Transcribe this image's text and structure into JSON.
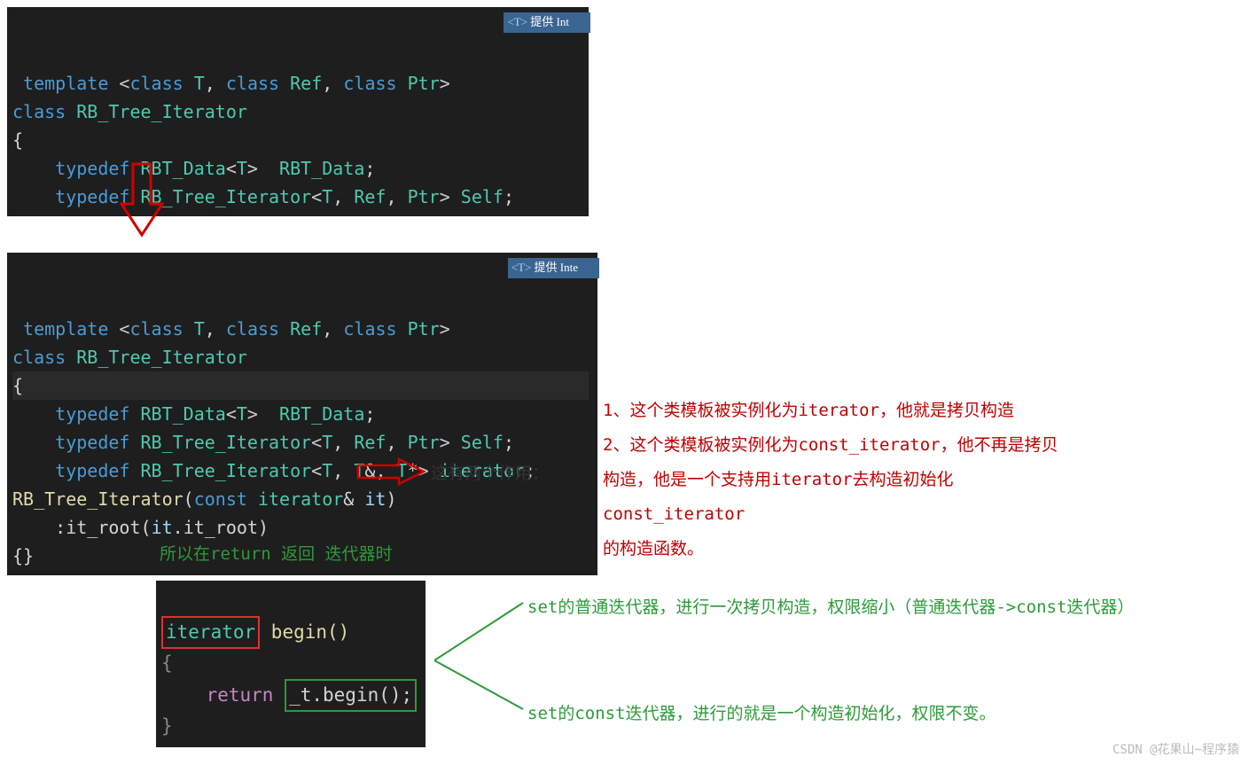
{
  "hint": {
    "tag": "<T>",
    "text": "提供 Int"
  },
  "hint2": {
    "tag": "<T>",
    "text": "提供 Inte"
  },
  "block1": {
    "l1": {
      "kw1": "template",
      "angle1": " <",
      "kw2": "class",
      "t": " T",
      "c1": ", ",
      "kw3": "class",
      "r": " Ref",
      "c2": ", ",
      "kw4": "class",
      "p": " Ptr",
      "angle2": ">"
    },
    "l2": {
      "kw": "class ",
      "name": "RB_Tree_Iterator"
    },
    "l3": "{",
    "l4": {
      "kw": "typedef ",
      "t1": "RBT_Data",
      "a1": "<",
      "tp": "T",
      "a2": ">  ",
      "t2": "RBT_Data",
      "end": ";"
    },
    "l5": {
      "kw": "typedef ",
      "t1": "RB_Tree_Iterator",
      "a1": "<",
      "tp": "T",
      "c1": ", ",
      "tr": "Ref",
      "c2": ", ",
      "tp2": "Ptr",
      "a2": "> ",
      "t2": "Self",
      "end": ";"
    }
  },
  "block2": {
    "l6": {
      "kw": "typedef ",
      "t1": "RB_Tree_Iterator",
      "a1": "<",
      "tp": "T",
      "c1": ", ",
      "tr": "T",
      "amp": "&",
      "c2": ", ",
      "tp2": "T",
      "star": "*",
      "a2": "> ",
      "t2": "iterator",
      "end": ";"
    },
    "ctor": {
      "name": "RB_Tree_Iterator",
      "p1": "(",
      "kw": "const ",
      "ty": "iterator",
      "amp": "& ",
      "arg": "it",
      "p2": ")"
    },
    "init": {
      "colon": ":",
      "m": "it_root",
      "p1": "(",
      "arg": "it",
      "dot": ".",
      "m2": "it_root",
      "p2": ")"
    },
    "end": "{}"
  },
  "anno_black": "这有两个作用：",
  "anno_red": {
    "l1": "1、这个类模板被实例化为iterator，他就是拷贝构造",
    "l2": "2、这个类模板被实例化为const_iterator，他不再是拷贝",
    "l3": "构造，他是一个支持用iterator去构造初始化const_iterator",
    "l4": "的构造函数。"
  },
  "anno_green_top": "所以在return 返回 迭代器时",
  "block3": {
    "l1a": "iterator",
    "l1b": " begin()",
    "l2": "{",
    "l3a": "return ",
    "l3b": "_t.begin();",
    "l4": "}"
  },
  "anno_green_r1": "set的普通迭代器，进行一次拷贝构造，权限缩小（普通迭代器->const迭代器）",
  "anno_green_r2": "set的const迭代器，进行的就是一个构造初始化，权限不变。",
  "watermark": "CSDN @花果山~程序猿"
}
